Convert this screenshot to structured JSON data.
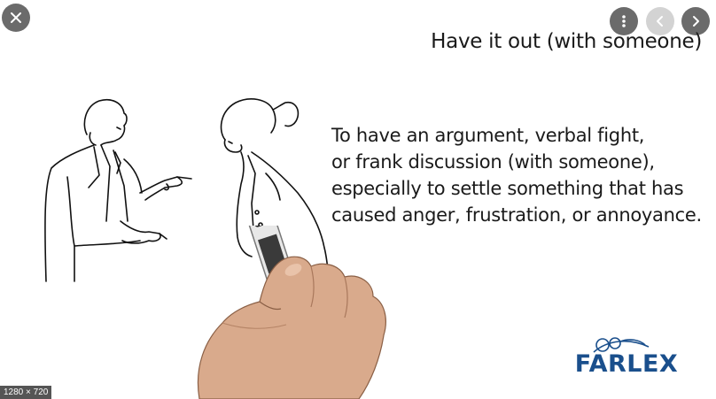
{
  "viewer": {
    "close_icon": "close-icon",
    "more_icon": "more-vert-icon",
    "prev_icon": "chevron-left-icon",
    "next_icon": "chevron-right-icon",
    "image_dimensions": "1280 × 720"
  },
  "slide": {
    "title": "Have it out (with someone)",
    "definition_lines": [
      "To have an argument, verbal fight,",
      "or frank discussion (with someone),",
      "especially to settle something that has",
      "caused anger, frustration, or annoyance."
    ],
    "logo_text": "FARLEX",
    "logo_color": "#1a4f8c"
  }
}
